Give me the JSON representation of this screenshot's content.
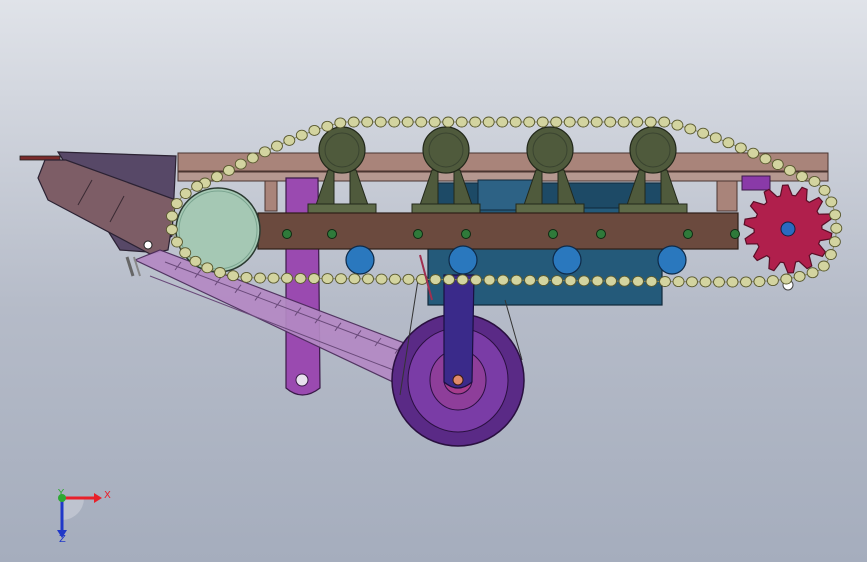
{
  "viewport": {
    "triad": {
      "x_label": "X",
      "y_label": "Y",
      "z_label": "Z",
      "x_color": "#e8202a",
      "y_color": "#2ea832",
      "z_color": "#2038c8"
    }
  },
  "colors": {
    "frame_rail": "#a9847a",
    "beam": "#6b4a3e",
    "chain_link": "#d3d4a0",
    "sprocket": "#b01f4c",
    "idler_wheel": "#a5c8b4",
    "motor": "#4f5a3c",
    "roller": "#2a78be",
    "housing": "#245a7a",
    "arm": "#9a4ab0",
    "flipper": "#b489c4",
    "wheel": "#5a2a86"
  }
}
